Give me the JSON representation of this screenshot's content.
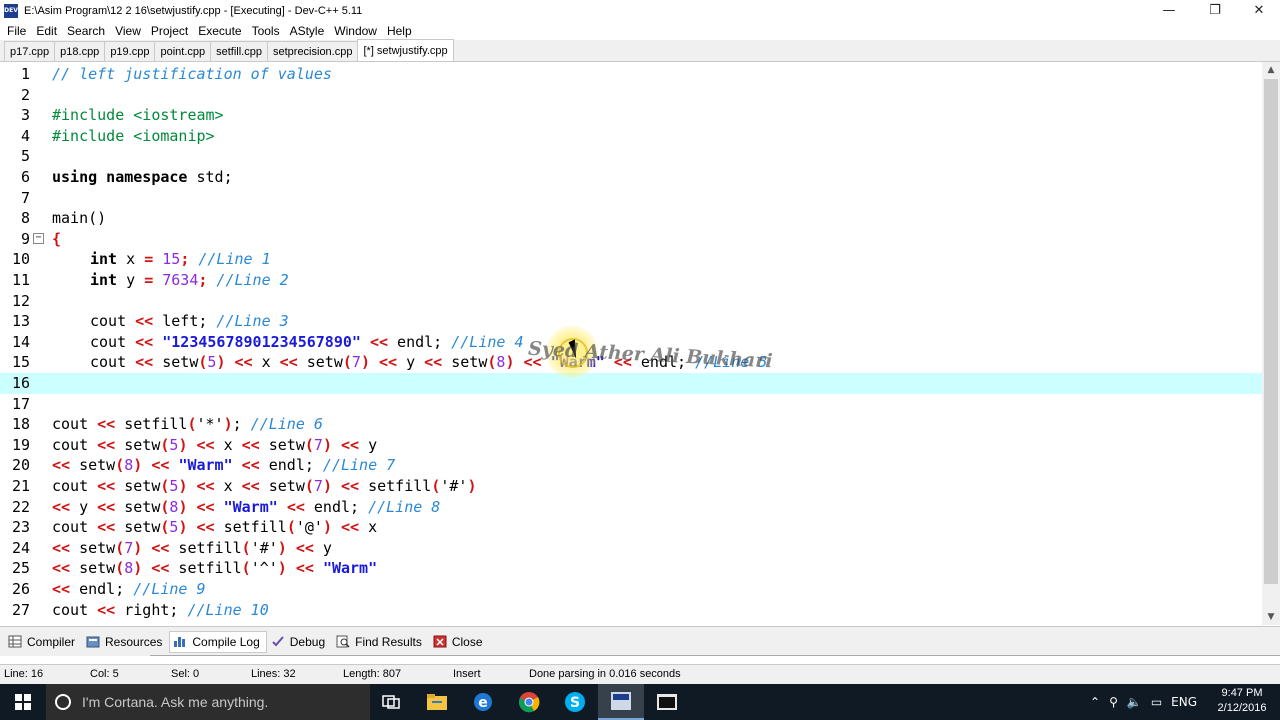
{
  "window": {
    "title": "E:\\Asim Program\\12 2 16\\setwjustify.cpp - [Executing] - Dev-C++ 5.11",
    "icon_text": "DEV",
    "minimize": "—",
    "restore": "❐",
    "close": "✕"
  },
  "menu": [
    "File",
    "Edit",
    "Search",
    "View",
    "Project",
    "Execute",
    "Tools",
    "AStyle",
    "Window",
    "Help"
  ],
  "tabs": [
    "p17.cpp",
    "p18.cpp",
    "p19.cpp",
    "point.cpp",
    "setfill.cpp",
    "setprecision.cpp",
    "[*] setwjustify.cpp"
  ],
  "active_tab_index": 6,
  "editor": {
    "current_line": 16,
    "lines": [
      {
        "n": "1"
      },
      {
        "n": "2"
      },
      {
        "n": "3"
      },
      {
        "n": "4"
      },
      {
        "n": "5"
      },
      {
        "n": "6"
      },
      {
        "n": "7"
      },
      {
        "n": "8"
      },
      {
        "n": "9"
      },
      {
        "n": "10"
      },
      {
        "n": "11"
      },
      {
        "n": "12"
      },
      {
        "n": "13"
      },
      {
        "n": "14"
      },
      {
        "n": "15"
      },
      {
        "n": "16"
      },
      {
        "n": "17"
      },
      {
        "n": "18"
      },
      {
        "n": "19"
      },
      {
        "n": "20"
      },
      {
        "n": "21"
      },
      {
        "n": "22"
      },
      {
        "n": "23"
      },
      {
        "n": "24"
      },
      {
        "n": "25"
      },
      {
        "n": "26"
      },
      {
        "n": "27"
      }
    ],
    "code": {
      "l1": "// left justification of values",
      "l3": "#include <iostream>",
      "l4": "#include <iomanip>",
      "l6_kw": "using namespace",
      "l6_rest": " std;",
      "l8": "main()",
      "l9": "{",
      "l10_kw": "int",
      "l10_a": " x ",
      "l10_eq": "=",
      "l10_sp": " ",
      "l10_num": "15",
      "l10_semi": ";",
      "l10_c": " //Line 1",
      "l11_kw": "int",
      "l11_a": " y ",
      "l11_eq": "=",
      "l11_sp": " ",
      "l11_num": "7634",
      "l11_semi": ";",
      "l11_c": " //Line 2",
      "l13_a": "cout ",
      "l13_op": "<<",
      "l13_b": " left;",
      "l13_c": " //Line 3",
      "l14_a": "cout ",
      "l14_op": "<<",
      "l14_str": "\"12345678901234567890\"",
      "l14_op2": "<<",
      "l14_b": " endl;",
      "l14_c": " //Line 4",
      "l15": [
        {
          "t": "cout ",
          "k": "p"
        },
        {
          "t": "<<",
          "k": "op"
        },
        {
          "t": " setw",
          "k": "p"
        },
        {
          "t": "(",
          "k": "op"
        },
        {
          "t": "5",
          "k": "num"
        },
        {
          "t": ")",
          "k": "op"
        },
        {
          "t": " ",
          "k": "p"
        },
        {
          "t": "<<",
          "k": "op"
        },
        {
          "t": " x ",
          "k": "p"
        },
        {
          "t": "<<",
          "k": "op"
        },
        {
          "t": " setw",
          "k": "p"
        },
        {
          "t": "(",
          "k": "op"
        },
        {
          "t": "7",
          "k": "num"
        },
        {
          "t": ")",
          "k": "op"
        },
        {
          "t": " ",
          "k": "p"
        },
        {
          "t": "<<",
          "k": "op"
        },
        {
          "t": " y ",
          "k": "p"
        },
        {
          "t": "<<",
          "k": "op"
        },
        {
          "t": " setw",
          "k": "p"
        },
        {
          "t": "(",
          "k": "op"
        },
        {
          "t": "8",
          "k": "num"
        },
        {
          "t": ")",
          "k": "op"
        },
        {
          "t": " ",
          "k": "p"
        },
        {
          "t": "<<",
          "k": "op"
        },
        {
          "t": " ",
          "k": "p"
        },
        {
          "t": "\"Warm\"",
          "k": "str"
        },
        {
          "t": " ",
          "k": "p"
        },
        {
          "t": "<<",
          "k": "op"
        },
        {
          "t": " endl;",
          "k": "p"
        },
        {
          "t": " //Line 5",
          "k": "c"
        }
      ],
      "l18": [
        {
          "t": "cout ",
          "k": "p"
        },
        {
          "t": "<<",
          "k": "op"
        },
        {
          "t": " setfill",
          "k": "p"
        },
        {
          "t": "(",
          "k": "op"
        },
        {
          "t": "'*'",
          "k": "sq"
        },
        {
          "t": ")",
          "k": "op"
        },
        {
          "t": ";",
          "k": "p"
        },
        {
          "t": " //Line 6",
          "k": "c"
        }
      ],
      "l19": [
        {
          "t": "cout ",
          "k": "p"
        },
        {
          "t": "<<",
          "k": "op"
        },
        {
          "t": " setw",
          "k": "p"
        },
        {
          "t": "(",
          "k": "op"
        },
        {
          "t": "5",
          "k": "num"
        },
        {
          "t": ")",
          "k": "op"
        },
        {
          "t": " ",
          "k": "p"
        },
        {
          "t": "<<",
          "k": "op"
        },
        {
          "t": " x ",
          "k": "p"
        },
        {
          "t": "<<",
          "k": "op"
        },
        {
          "t": " setw",
          "k": "p"
        },
        {
          "t": "(",
          "k": "op"
        },
        {
          "t": "7",
          "k": "num"
        },
        {
          "t": ")",
          "k": "op"
        },
        {
          "t": " ",
          "k": "p"
        },
        {
          "t": "<<",
          "k": "op"
        },
        {
          "t": " y",
          "k": "p"
        }
      ],
      "l20": [
        {
          "t": "<<",
          "k": "op"
        },
        {
          "t": " setw",
          "k": "p"
        },
        {
          "t": "(",
          "k": "op"
        },
        {
          "t": "8",
          "k": "num"
        },
        {
          "t": ")",
          "k": "op"
        },
        {
          "t": " ",
          "k": "p"
        },
        {
          "t": "<<",
          "k": "op"
        },
        {
          "t": " ",
          "k": "p"
        },
        {
          "t": "\"Warm\"",
          "k": "str"
        },
        {
          "t": " ",
          "k": "p"
        },
        {
          "t": "<<",
          "k": "op"
        },
        {
          "t": " endl;",
          "k": "p"
        },
        {
          "t": " //Line 7",
          "k": "c"
        }
      ],
      "l21": [
        {
          "t": "cout ",
          "k": "p"
        },
        {
          "t": "<<",
          "k": "op"
        },
        {
          "t": " setw",
          "k": "p"
        },
        {
          "t": "(",
          "k": "op"
        },
        {
          "t": "5",
          "k": "num"
        },
        {
          "t": ")",
          "k": "op"
        },
        {
          "t": " ",
          "k": "p"
        },
        {
          "t": "<<",
          "k": "op"
        },
        {
          "t": " x ",
          "k": "p"
        },
        {
          "t": "<<",
          "k": "op"
        },
        {
          "t": " setw",
          "k": "p"
        },
        {
          "t": "(",
          "k": "op"
        },
        {
          "t": "7",
          "k": "num"
        },
        {
          "t": ")",
          "k": "op"
        },
        {
          "t": " ",
          "k": "p"
        },
        {
          "t": "<<",
          "k": "op"
        },
        {
          "t": " setfill",
          "k": "p"
        },
        {
          "t": "(",
          "k": "op"
        },
        {
          "t": "'#'",
          "k": "sq"
        },
        {
          "t": ")",
          "k": "op"
        }
      ],
      "l22": [
        {
          "t": "<<",
          "k": "op"
        },
        {
          "t": " y ",
          "k": "p"
        },
        {
          "t": "<<",
          "k": "op"
        },
        {
          "t": " setw",
          "k": "p"
        },
        {
          "t": "(",
          "k": "op"
        },
        {
          "t": "8",
          "k": "num"
        },
        {
          "t": ")",
          "k": "op"
        },
        {
          "t": " ",
          "k": "p"
        },
        {
          "t": "<<",
          "k": "op"
        },
        {
          "t": " ",
          "k": "p"
        },
        {
          "t": "\"Warm\"",
          "k": "str"
        },
        {
          "t": " ",
          "k": "p"
        },
        {
          "t": "<<",
          "k": "op"
        },
        {
          "t": " endl;",
          "k": "p"
        },
        {
          "t": " //Line 8",
          "k": "c"
        }
      ],
      "l23": [
        {
          "t": "cout ",
          "k": "p"
        },
        {
          "t": "<<",
          "k": "op"
        },
        {
          "t": " setw",
          "k": "p"
        },
        {
          "t": "(",
          "k": "op"
        },
        {
          "t": "5",
          "k": "num"
        },
        {
          "t": ")",
          "k": "op"
        },
        {
          "t": " ",
          "k": "p"
        },
        {
          "t": "<<",
          "k": "op"
        },
        {
          "t": " setfill",
          "k": "p"
        },
        {
          "t": "(",
          "k": "op"
        },
        {
          "t": "'@'",
          "k": "sq"
        },
        {
          "t": ")",
          "k": "op"
        },
        {
          "t": " ",
          "k": "p"
        },
        {
          "t": "<<",
          "k": "op"
        },
        {
          "t": " x",
          "k": "p"
        }
      ],
      "l24": [
        {
          "t": "<<",
          "k": "op"
        },
        {
          "t": " setw",
          "k": "p"
        },
        {
          "t": "(",
          "k": "op"
        },
        {
          "t": "7",
          "k": "num"
        },
        {
          "t": ")",
          "k": "op"
        },
        {
          "t": " ",
          "k": "p"
        },
        {
          "t": "<<",
          "k": "op"
        },
        {
          "t": " setfill",
          "k": "p"
        },
        {
          "t": "(",
          "k": "op"
        },
        {
          "t": "'#'",
          "k": "sq"
        },
        {
          "t": ")",
          "k": "op"
        },
        {
          "t": " ",
          "k": "p"
        },
        {
          "t": "<<",
          "k": "op"
        },
        {
          "t": " y",
          "k": "p"
        }
      ],
      "l25": [
        {
          "t": "<<",
          "k": "op"
        },
        {
          "t": " setw",
          "k": "p"
        },
        {
          "t": "(",
          "k": "op"
        },
        {
          "t": "8",
          "k": "num"
        },
        {
          "t": ")",
          "k": "op"
        },
        {
          "t": " ",
          "k": "p"
        },
        {
          "t": "<<",
          "k": "op"
        },
        {
          "t": " setfill",
          "k": "p"
        },
        {
          "t": "(",
          "k": "op"
        },
        {
          "t": "'^'",
          "k": "sq"
        },
        {
          "t": ")",
          "k": "op"
        },
        {
          "t": " ",
          "k": "p"
        },
        {
          "t": "<<",
          "k": "op"
        },
        {
          "t": " ",
          "k": "p"
        },
        {
          "t": "\"Warm\"",
          "k": "str"
        }
      ],
      "l26": [
        {
          "t": "<<",
          "k": "op"
        },
        {
          "t": " endl;",
          "k": "p"
        },
        {
          "t": " //Line 9",
          "k": "c"
        }
      ],
      "l27": [
        {
          "t": "cout ",
          "k": "p"
        },
        {
          "t": "<<",
          "k": "op"
        },
        {
          "t": " right;",
          "k": "p"
        },
        {
          "t": " //Line 10",
          "k": "c"
        }
      ]
    },
    "fold_marker": "−",
    "watermark": "Syed Ather Ali Bukhari"
  },
  "bottom_tabs": [
    {
      "label": "Compiler",
      "icon": "grid-icon"
    },
    {
      "label": "Resources",
      "icon": "resources-icon"
    },
    {
      "label": "Compile Log",
      "icon": "chart-icon"
    },
    {
      "label": "Debug",
      "icon": "check-icon"
    },
    {
      "label": "Find Results",
      "icon": "find-icon"
    },
    {
      "label": "Close",
      "icon": "close-icon"
    }
  ],
  "active_bottom_tab_index": 2,
  "status": {
    "line": "Line:   16",
    "col": "Col:   5",
    "sel": "Sel:   0",
    "lines": "Lines:   32",
    "length": "Length:   807",
    "mode": "Insert",
    "message": "Done parsing in 0.016 seconds"
  },
  "taskbar": {
    "search_placeholder": "I'm Cortana. Ask me anything.",
    "language": "ENG",
    "time": "9:47 PM",
    "date": "2/12/2016",
    "icons": [
      "task-view-icon",
      "file-explorer-icon",
      "edge-icon",
      "chrome-icon",
      "skype-icon",
      "devcpp-icon",
      "console-icon"
    ]
  },
  "colors": {
    "keyword": "#000000",
    "operator": "#d11313",
    "number": "#8a2be2",
    "string": "#1a1adb",
    "comment": "#2a88d6",
    "preprocessor": "#008a3a",
    "current_line": "#ccffff",
    "taskbar": "#101a24"
  }
}
